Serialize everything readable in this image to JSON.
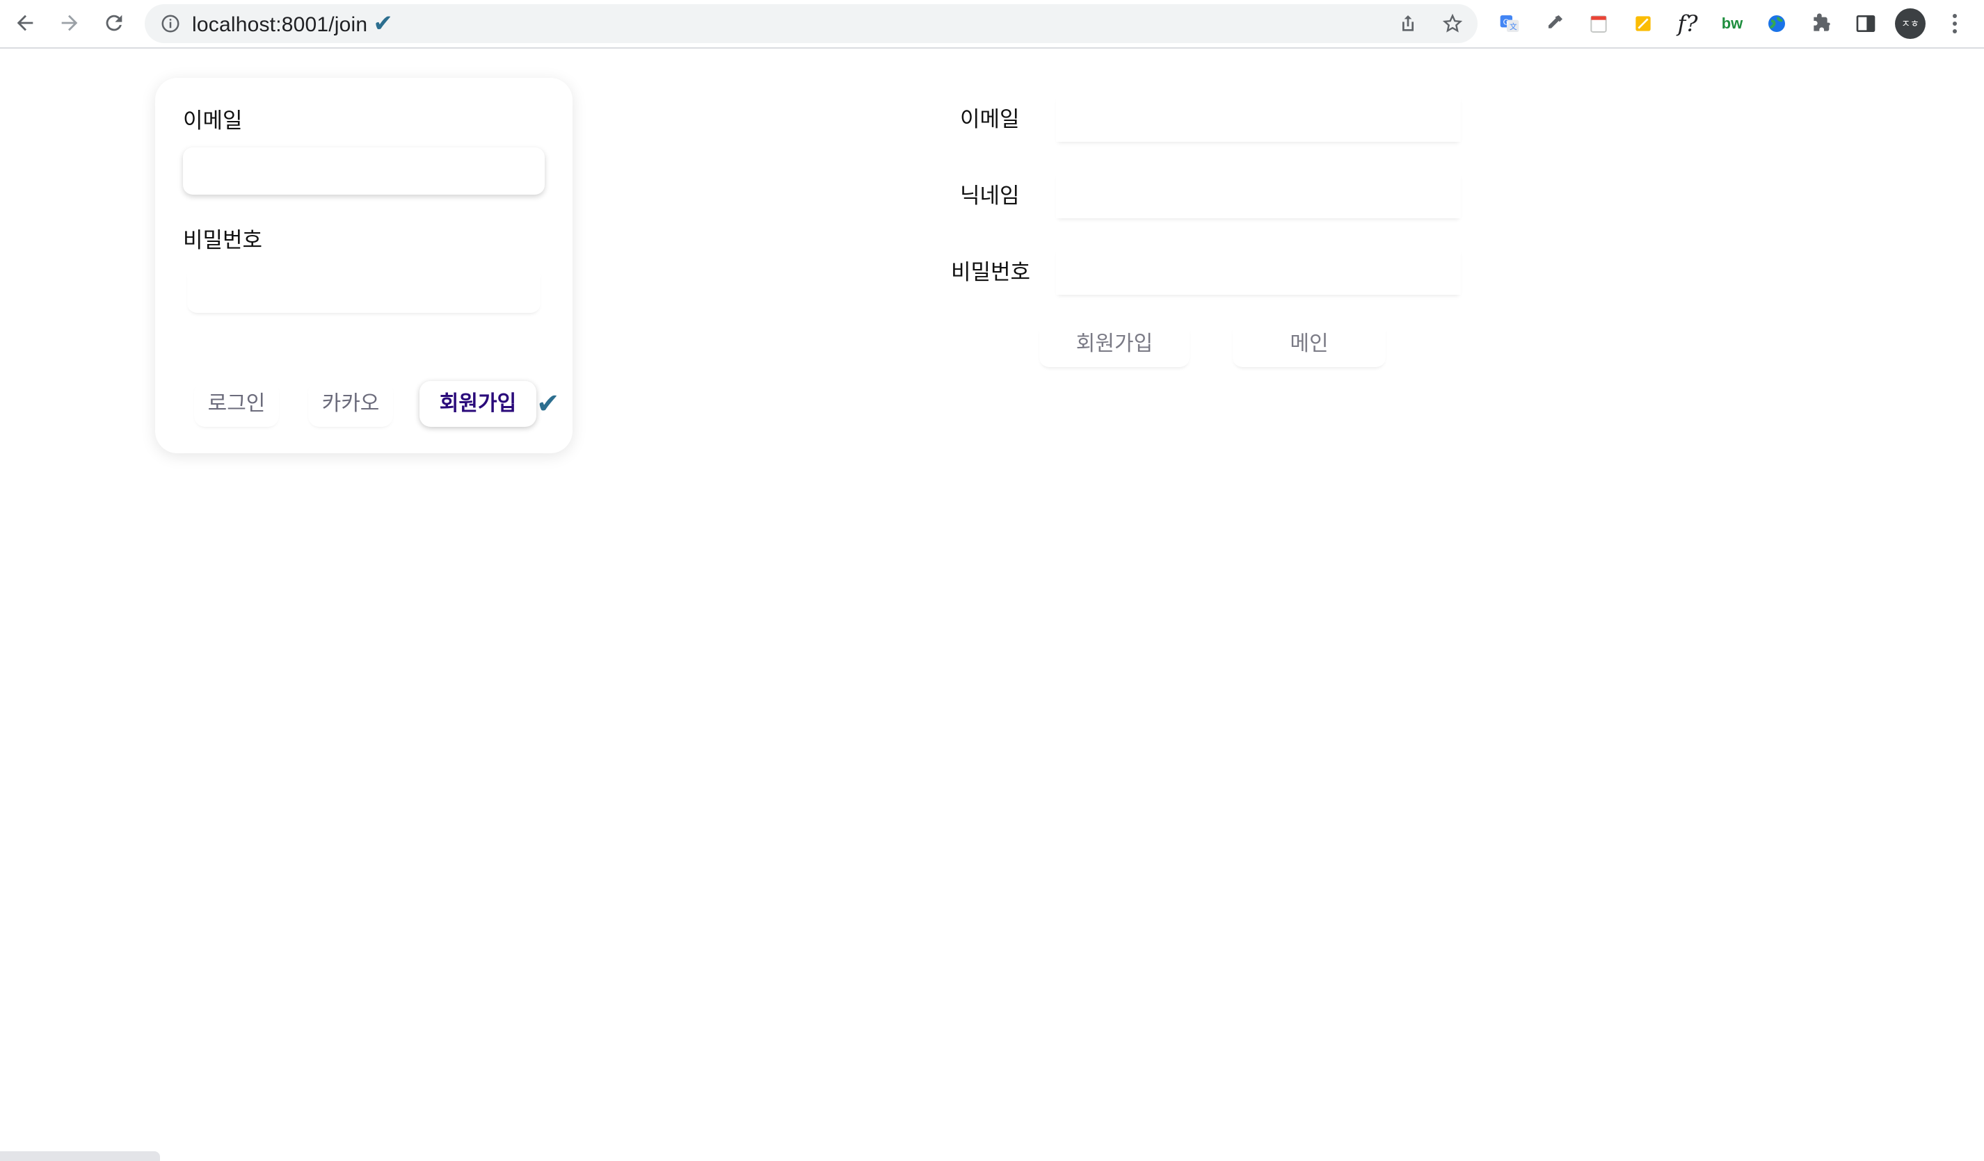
{
  "browser": {
    "url": "localhost:8001/join",
    "url_check": "✔",
    "avatar_text": "ㅈㅎ",
    "extensions": [
      "google-translate-icon",
      "eyedropper-icon",
      "calendar-icon",
      "notes-icon",
      "font-finder-icon",
      "bw-icon",
      "globe-icon",
      "puzzle-icon",
      "side-panel-icon"
    ],
    "ext_labels": {
      "font_finder": "f?",
      "bw": "bw"
    }
  },
  "login_card": {
    "email_label": "이메일",
    "password_label": "비밀번호",
    "email_value": "",
    "password_value": "",
    "buttons": {
      "login": "로그인",
      "kakao": "카카오",
      "join": "회원가입"
    },
    "active_check": "✔"
  },
  "join_form": {
    "email_label": "이메일",
    "nickname_label": "닉네임",
    "password_label": "비밀번호",
    "email_value": "",
    "nickname_value": "",
    "password_value": "",
    "buttons": {
      "join": "회원가입",
      "main": "메인"
    }
  },
  "colors": {
    "active_button_text": "#2a0a7a",
    "checkmark": "#2c6e8f",
    "muted_text": "#6b6b7b"
  }
}
